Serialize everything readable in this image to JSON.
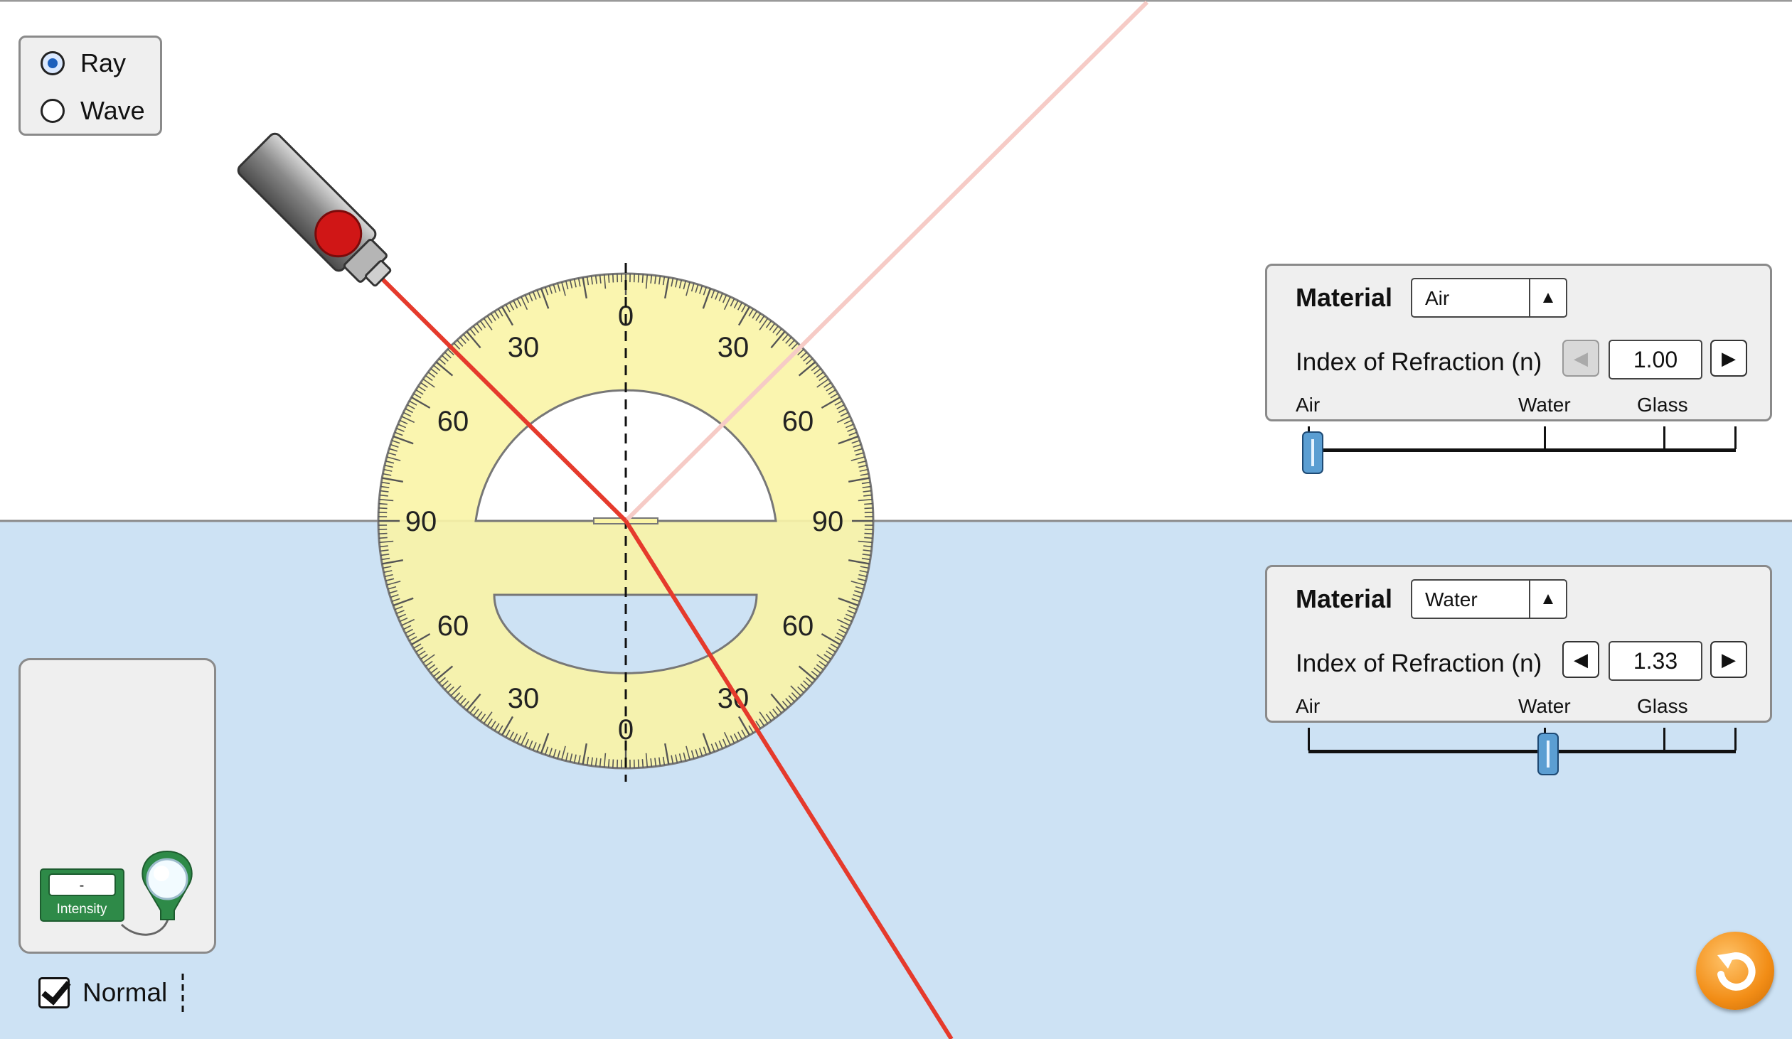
{
  "mode": {
    "options": [
      "Ray",
      "Wave"
    ],
    "selected": "Ray"
  },
  "top_medium": {
    "material_label": "Material",
    "material_value": "Air",
    "ior_label": "Index of Refraction (n)",
    "ior_value": "1.00",
    "slider_fraction": 0,
    "slider_labels": [
      "Air",
      "Water",
      "Glass"
    ]
  },
  "bottom_medium": {
    "material_label": "Material",
    "material_value": "Water",
    "ior_label": "Index of Refraction (n)",
    "ior_value": "1.33",
    "slider_fraction": 0.55,
    "slider_labels": [
      "Air",
      "Water",
      "Glass"
    ]
  },
  "protractor": {
    "labels_top": [
      "30",
      "0",
      "30",
      "60",
      "60",
      "90",
      "90"
    ],
    "labels_bottom": [
      "60",
      "60",
      "30",
      "0",
      "30"
    ]
  },
  "intensity_meter": {
    "readout": "-",
    "label": "Intensity"
  },
  "normal_checkbox": {
    "label": "Normal",
    "checked": true
  },
  "colors": {
    "upper_medium": "#ffffff",
    "lower_medium": "#cde2f4",
    "laser_beam": "#e53a2c",
    "reflected_beam": "#f6cbc6",
    "protractor": "#faf4a6",
    "meter_green": "#2e8a48",
    "reset_orange": "#f28d16"
  }
}
